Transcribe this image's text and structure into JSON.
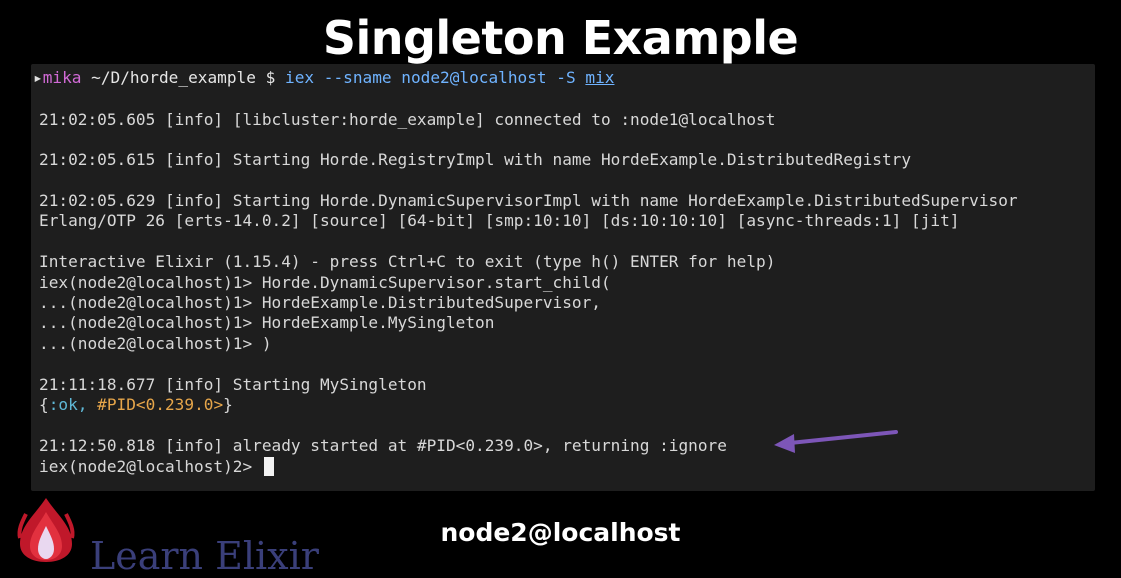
{
  "slide": {
    "title": "Singleton Example",
    "footer_node": "node2@localhost",
    "logo_text": "Learn Elixir"
  },
  "terminal": {
    "prompt": {
      "user": "mika",
      "path": "~/D/horde_example",
      "symbol": "$",
      "command": "iex --sname node2@localhost -S",
      "argument": "mix"
    },
    "lines": [
      "21:02:05.605 [info] [libcluster:horde_example] connected to :node1@localhost",
      "21:02:05.615 [info] Starting Horde.RegistryImpl with name HordeExample.DistributedRegistry",
      "21:02:05.629 [info] Starting Horde.DynamicSupervisorImpl with name HordeExample.DistributedSupervisor",
      "Erlang/OTP 26 [erts-14.0.2] [source] [64-bit] [smp:10:10] [ds:10:10:10] [async-threads:1] [jit]",
      "Interactive Elixir (1.15.4) - press Ctrl+C to exit (type h() ENTER for help)",
      "iex(node2@localhost)1> Horde.DynamicSupervisor.start_child(",
      "...(node2@localhost)1> HordeExample.DistributedSupervisor,",
      "...(node2@localhost)1> HordeExample.MySingleton",
      "...(node2@localhost)1> )",
      "21:11:18.677 [info] Starting MySingleton",
      "21:12:50.818 [info] already started at #PID<0.239.0>, returning :ignore"
    ],
    "result": {
      "open": "{",
      "atom": ":ok,",
      "pid": "#PID<0.239.0>",
      "close": "}"
    },
    "current_prompt": "iex(node2@localhost)2>"
  },
  "colors": {
    "terminal_bg": "#1e1e1e",
    "arrow": "#7d56b8",
    "prompt_user": "#d16ad6",
    "command": "#6fb3ff"
  },
  "icons": {
    "annotation": "arrow-left-icon",
    "logo": "flame-drop-logo"
  }
}
